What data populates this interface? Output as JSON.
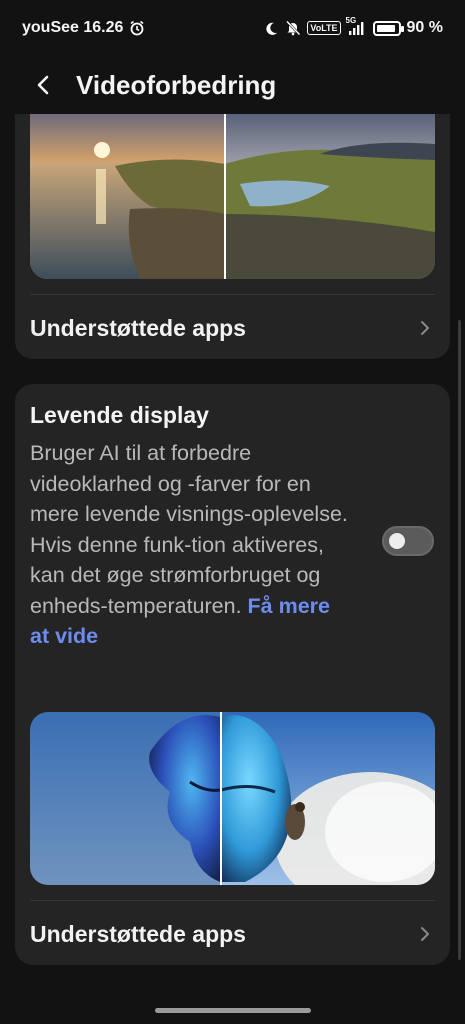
{
  "status_bar": {
    "carrier_time": "youSee 16.26",
    "volte": "VoLTE",
    "network": "5G",
    "battery_text": "90 %",
    "battery_level": 0.9
  },
  "header": {
    "title": "Videoforbedring"
  },
  "card1": {
    "supported_apps_label": "Understøttede apps"
  },
  "card2": {
    "title": "Levende display",
    "description": "Bruger AI til at forbedre videoklarhed og -farver for en mere levende visnings-oplevelse. Hvis denne funk-tion aktiveres, kan det øge strømforbruget og enheds-temperaturen.",
    "learn_more": "Få mere at vide",
    "toggle_on": false,
    "supported_apps_label": "Understøttede apps"
  },
  "colors": {
    "background": "#121212",
    "card": "#242424",
    "link": "#6c8cf0"
  }
}
